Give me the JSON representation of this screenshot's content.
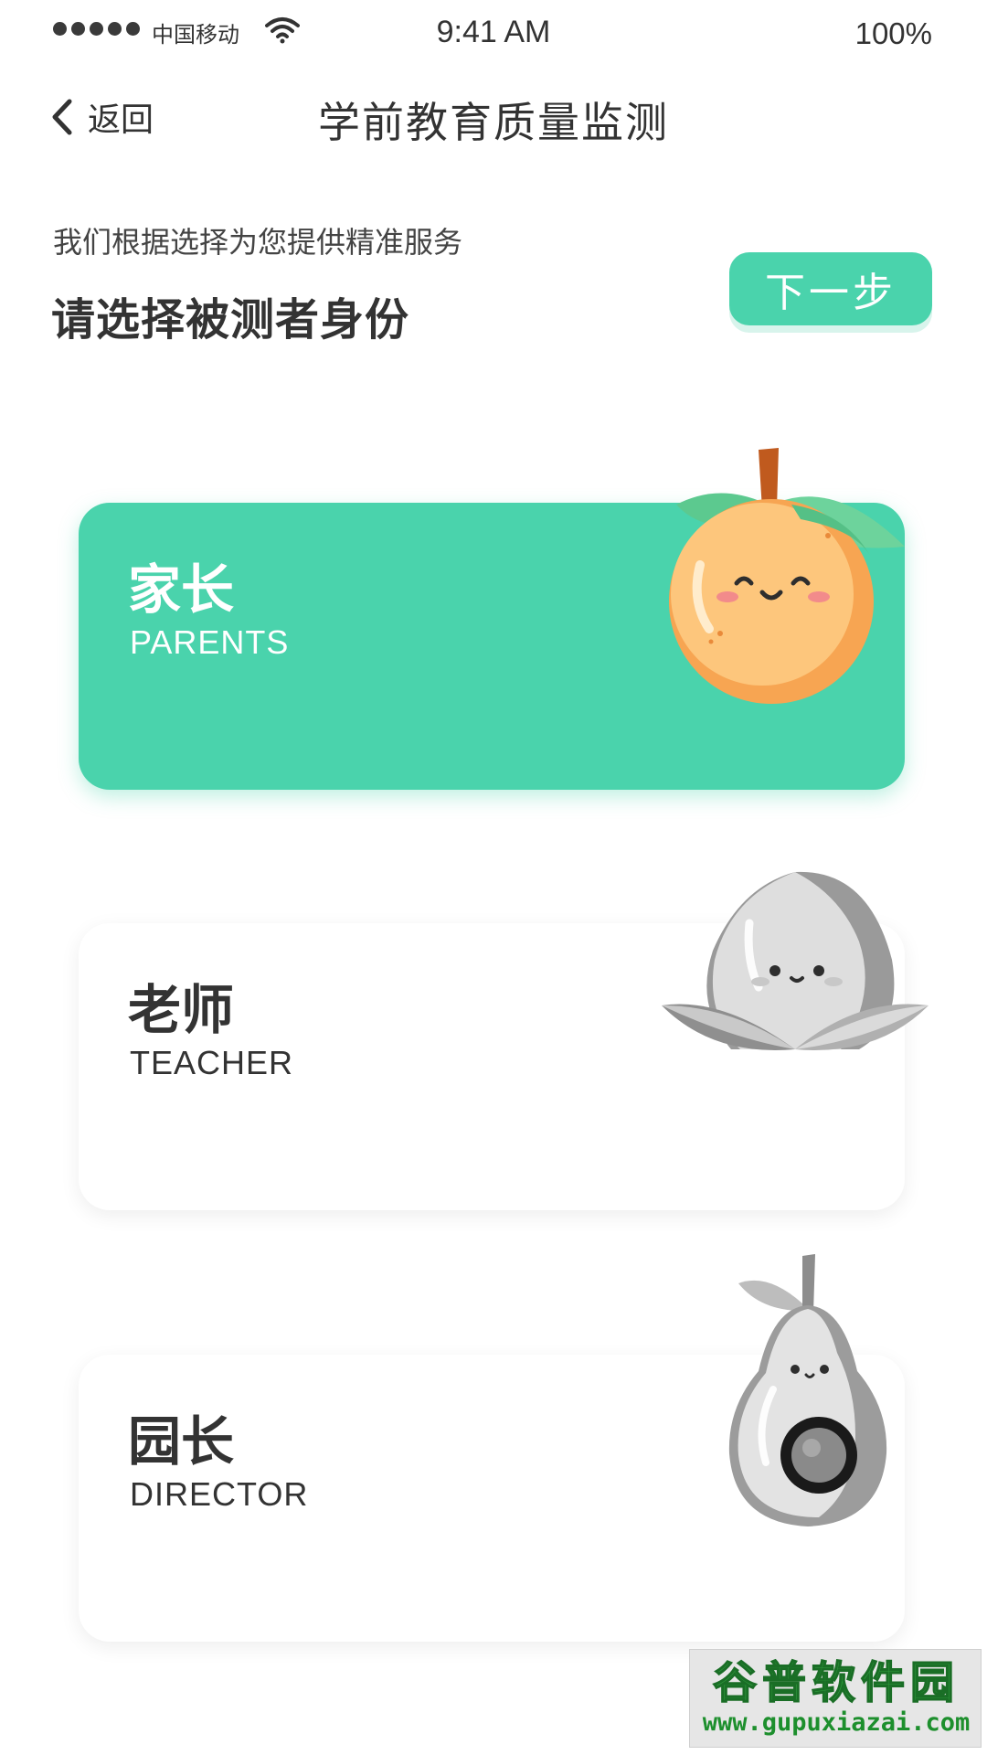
{
  "status_bar": {
    "carrier": "中国移动",
    "time": "9:41 AM",
    "battery": "100%",
    "signal_icon": "signal-dots-icon",
    "wifi_icon": "wifi-icon"
  },
  "nav": {
    "back_label": "返回",
    "back_icon": "chevron-left-icon",
    "title": "学前教育质量监测"
  },
  "prompt": {
    "subtitle": "我们根据选择为您提供精准服务",
    "heading": "请选择被测者身份",
    "next_label": "下一步"
  },
  "roles": [
    {
      "cn": "家长",
      "en": "PARENTS",
      "selected": true,
      "mascot": "orange-mascot"
    },
    {
      "cn": "老师",
      "en": "TEACHER",
      "selected": false,
      "mascot": "peach-mascot"
    },
    {
      "cn": "园长",
      "en": "DIRECTOR",
      "selected": false,
      "mascot": "pear-mascot"
    }
  ],
  "watermark": {
    "logo_text": "谷普软件园",
    "url": "www.gupuxiazai.com"
  },
  "colors": {
    "accent": "#4ad3ac",
    "text": "#333333",
    "card_bg": "#ffffff",
    "orange": "#f7a552",
    "watermark_green": "#1d8f2d"
  }
}
